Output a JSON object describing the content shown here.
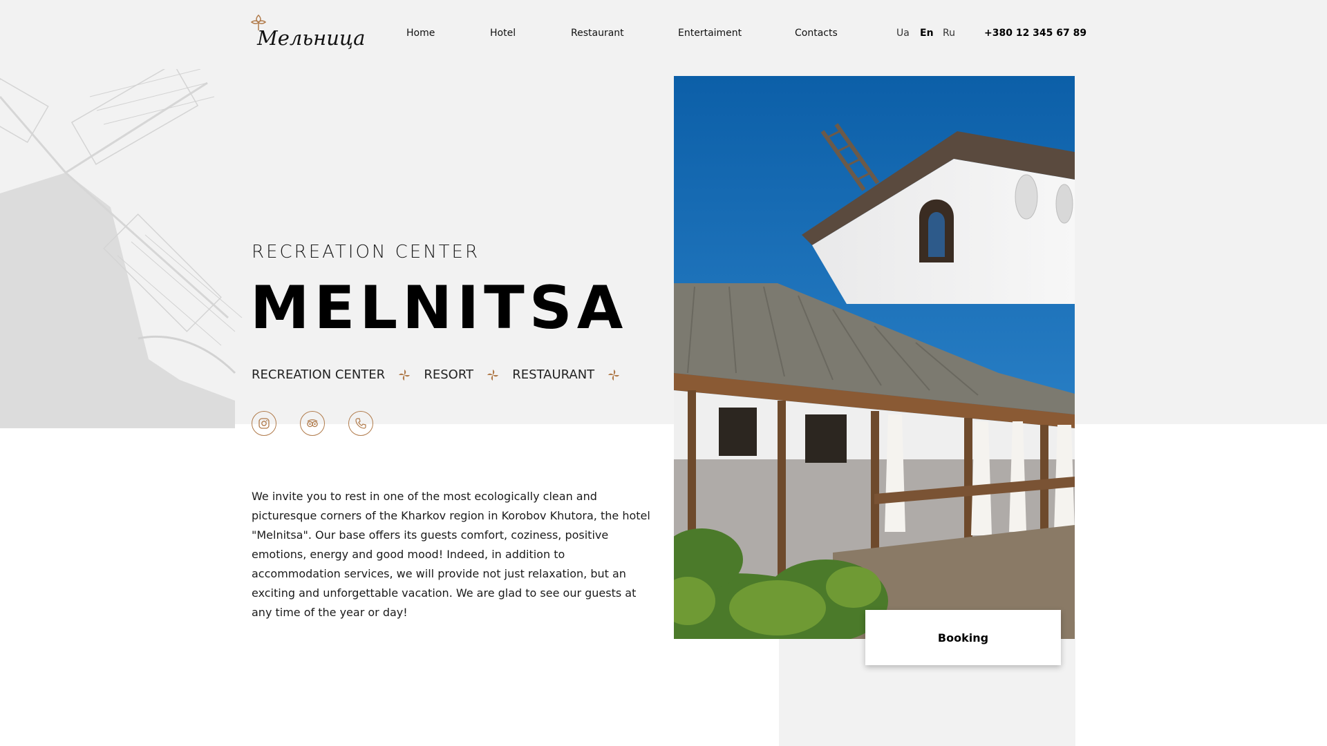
{
  "logo": {
    "text": "Мельница",
    "icon": "flower-icon"
  },
  "nav": {
    "items": [
      {
        "label": "Home"
      },
      {
        "label": "Hotel"
      },
      {
        "label": "Restaurant"
      },
      {
        "label": "Entertaiment"
      },
      {
        "label": "Contacts"
      }
    ]
  },
  "languages": [
    {
      "label": "Ua",
      "active": false
    },
    {
      "label": "En",
      "active": true
    },
    {
      "label": "Ru",
      "active": false
    }
  ],
  "phone": "+380 12 345 67 89",
  "hero": {
    "subtitle": "RECREATION CENTER",
    "title": "MELNITSA",
    "tags": [
      "RECREATION CENTER",
      "RESORT",
      "RESTAURANT"
    ],
    "tag_separator_icon": "pinwheel-icon"
  },
  "socials": [
    {
      "icon": "instagram-icon"
    },
    {
      "icon": "tripadvisor-icon"
    },
    {
      "icon": "phone-icon"
    }
  ],
  "description": "We invite you to rest in one of the most ecologically clean and picturesque corners of the Kharkov region in Korobov Khutora, the hotel \"Melnitsa\". Our base offers its guests comfort, coziness, positive emotions, energy and good mood! Indeed, in addition to accommodation services, we will provide not just relaxation, but an exciting and unforgettable vacation. We are glad to see our guests at any time of the year or day!",
  "booking": {
    "label": "Booking"
  },
  "colors": {
    "accent": "#b07a4a",
    "background_grey": "#f2f2f2",
    "text": "#111111"
  }
}
